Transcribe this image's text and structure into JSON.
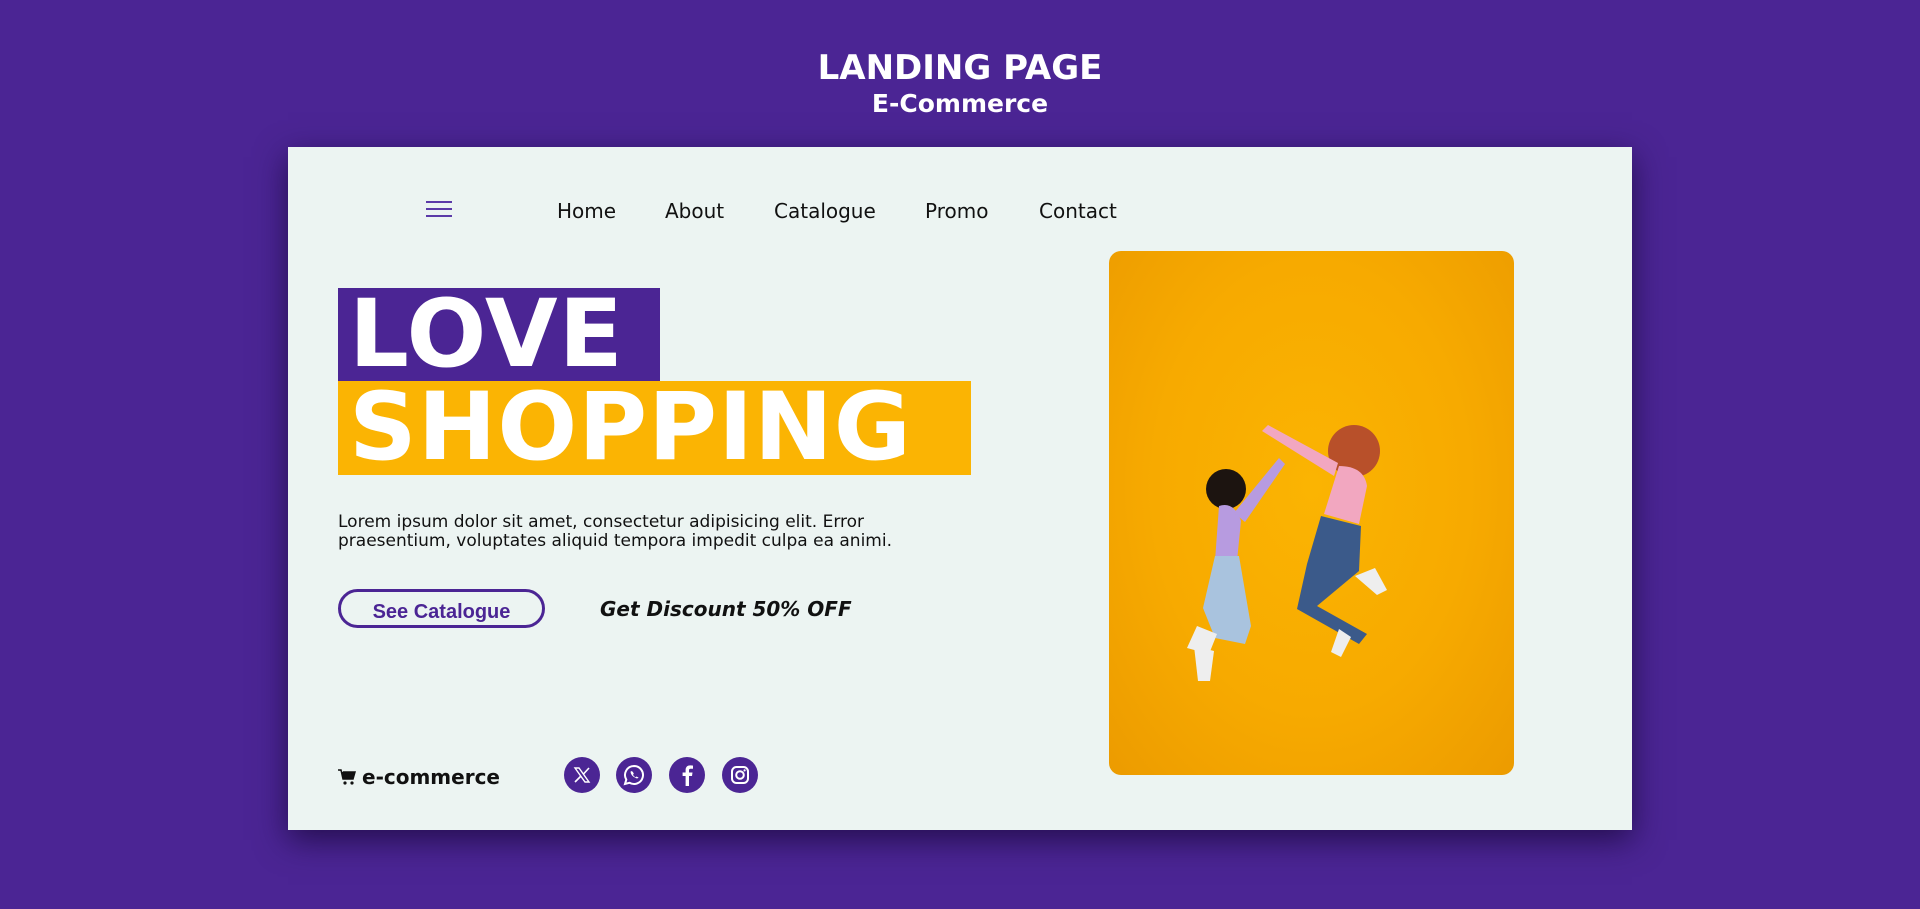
{
  "header": {
    "title": "LANDING PAGE",
    "subtitle": "E-Commerce"
  },
  "nav": {
    "menu_icon": "hamburger-icon",
    "items": [
      {
        "label": "Home"
      },
      {
        "label": "About"
      },
      {
        "label": "Catalogue"
      },
      {
        "label": "Promo"
      },
      {
        "label": "Contact"
      }
    ]
  },
  "hero": {
    "line1": "LOVE",
    "line2": "SHOPPING",
    "description": "Lorem ipsum dolor sit amet, consectetur adipisicing elit. Error praesentium, voluptates aliquid tempora impedit culpa ea animi.",
    "cta_label": "See Catalogue",
    "discount": "Get Discount 50% OFF"
  },
  "footer": {
    "brand": "e-commerce",
    "brand_icon": "cart-icon",
    "social": [
      "x-icon",
      "whatsapp-icon",
      "facebook-icon",
      "instagram-icon"
    ]
  },
  "colors": {
    "background": "#4b2594",
    "accent": "#fbb403",
    "card": "#ecf4f2"
  }
}
